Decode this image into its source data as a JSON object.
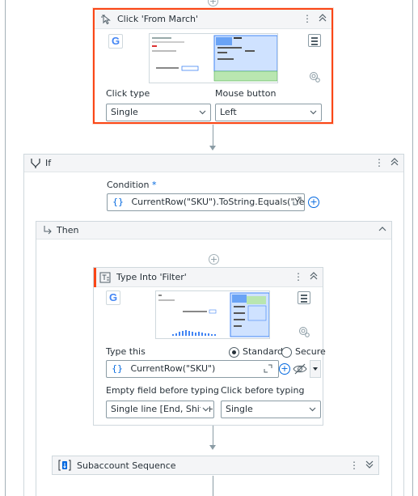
{
  "click_activity": {
    "title": "Click 'From March'",
    "click_type_label": "Click type",
    "click_type_value": "Single",
    "mouse_button_label": "Mouse button",
    "mouse_button_value": "Left"
  },
  "if_activity": {
    "title": "If",
    "condition_label": "Condition",
    "condition_required_mark": "*",
    "condition_value": "CurrentRow(\"SKU\").ToString.Equals(\"Yes\")",
    "then_label": "Then"
  },
  "type_into_activity": {
    "title": "Type Into 'Filter'",
    "type_this_label": "Type this",
    "type_this_value": "CurrentRow(\"SKU\")",
    "mode_standard": "Standard",
    "mode_secure": "Secure",
    "empty_field_label": "Empty field before typing",
    "empty_field_value": "Single line [End, Shift+H",
    "click_before_label": "Click before typing",
    "click_before_value": "Single"
  },
  "subaccount_sequence": {
    "title": "Subaccount Sequence"
  },
  "icons": {
    "expression": "{}",
    "google": "G",
    "plus": "+",
    "expand": "⌃",
    "kebab": "⋮",
    "chevron_down": "⌄"
  },
  "colors": {
    "selected_border": "#fa4616",
    "accent": "#0067df",
    "google_blue": "#4285f4"
  }
}
